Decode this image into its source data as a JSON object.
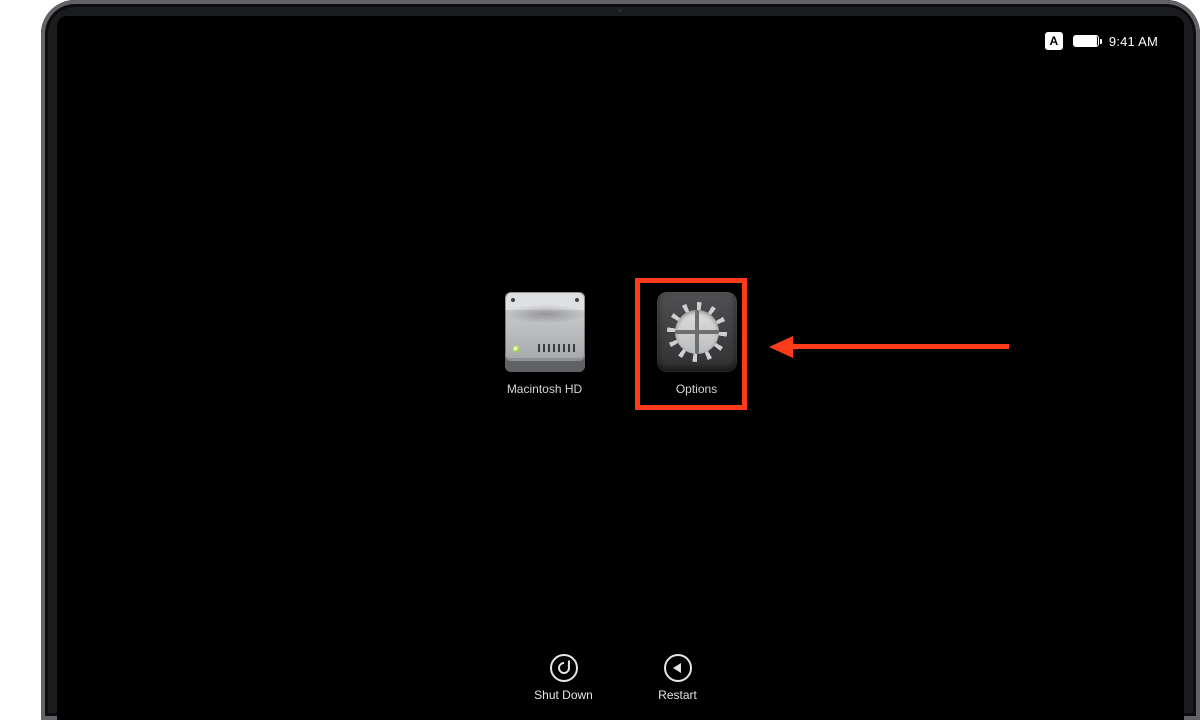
{
  "status": {
    "indicator": "A",
    "time": "9:41 AM"
  },
  "boot_targets": {
    "disk_label": "Macintosh HD",
    "options_label": "Options"
  },
  "actions": {
    "shutdown_label": "Shut Down",
    "restart_label": "Restart"
  },
  "annotation": {
    "highlight_color": "#ff3b1a"
  }
}
